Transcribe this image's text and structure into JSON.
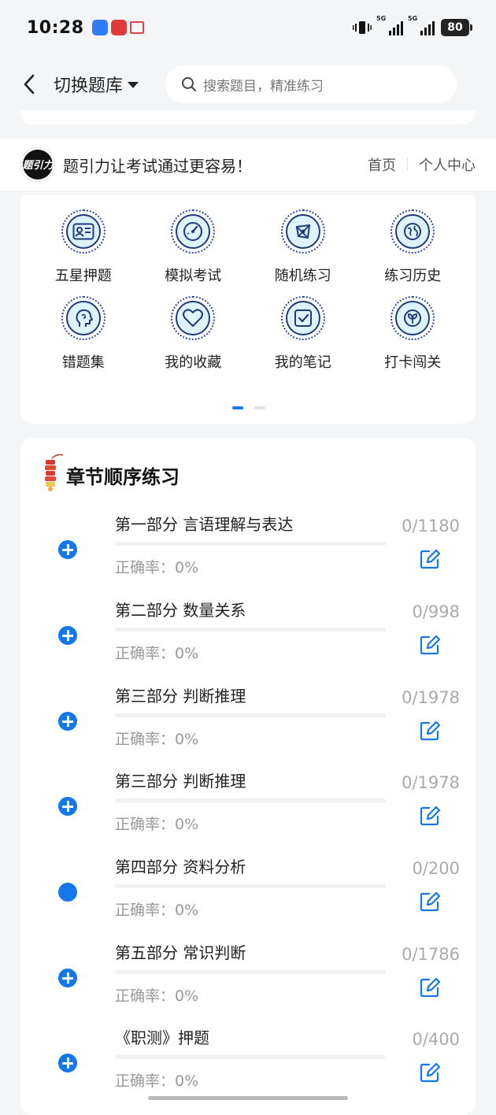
{
  "status_bar": {
    "time": "10:28",
    "battery": "80",
    "net1": "5G",
    "net2": "5G"
  },
  "header": {
    "switch_label": "切换题库",
    "search_placeholder": "搜索题目，精准练习"
  },
  "promo": {
    "logo_text": "题引力",
    "slogan": "题引力让考试通过更容易！",
    "links": [
      "首页",
      "个人中心"
    ]
  },
  "grid": {
    "items": [
      {
        "label": "五星押题",
        "icon": "id-card-icon"
      },
      {
        "label": "模拟考试",
        "icon": "gauge-icon"
      },
      {
        "label": "随机练习",
        "icon": "network-icon"
      },
      {
        "label": "练习历史",
        "icon": "globe-icon"
      },
      {
        "label": "错题集",
        "icon": "head-icon"
      },
      {
        "label": "我的收藏",
        "icon": "heart-icon"
      },
      {
        "label": "我的笔记",
        "icon": "note-check-icon"
      },
      {
        "label": "打卡闯关",
        "icon": "leaf-icon"
      }
    ],
    "page_indicator": {
      "current": 1,
      "total": 2
    }
  },
  "chapters": {
    "title": "章节顺序练习",
    "rows": [
      {
        "name": "第一部分 言语理解与表达",
        "rate": "正确率：0%",
        "count": "0/1180",
        "expandable": true
      },
      {
        "name": "第二部分 数量关系",
        "rate": "正确率：0%",
        "count": "0/998",
        "expandable": true
      },
      {
        "name": "第三部分 判断推理",
        "rate": "正确率：0%",
        "count": "0/1978",
        "expandable": true
      },
      {
        "name": "第三部分 判断推理",
        "rate": "正确率：0%",
        "count": "0/1978",
        "expandable": true
      },
      {
        "name": "第四部分 资料分析",
        "rate": "正确率：0%",
        "count": "0/200",
        "expandable": false
      },
      {
        "name": "第五部分 常识判断",
        "rate": "正确率：0%",
        "count": "0/1786",
        "expandable": true
      },
      {
        "name": "《职测》押题",
        "rate": "正确率：0%",
        "count": "0/400",
        "expandable": true
      }
    ]
  },
  "colors": {
    "accent": "#1677e8",
    "icon_bg": "#dff3ff",
    "icon_stroke": "#1e3a7a"
  }
}
